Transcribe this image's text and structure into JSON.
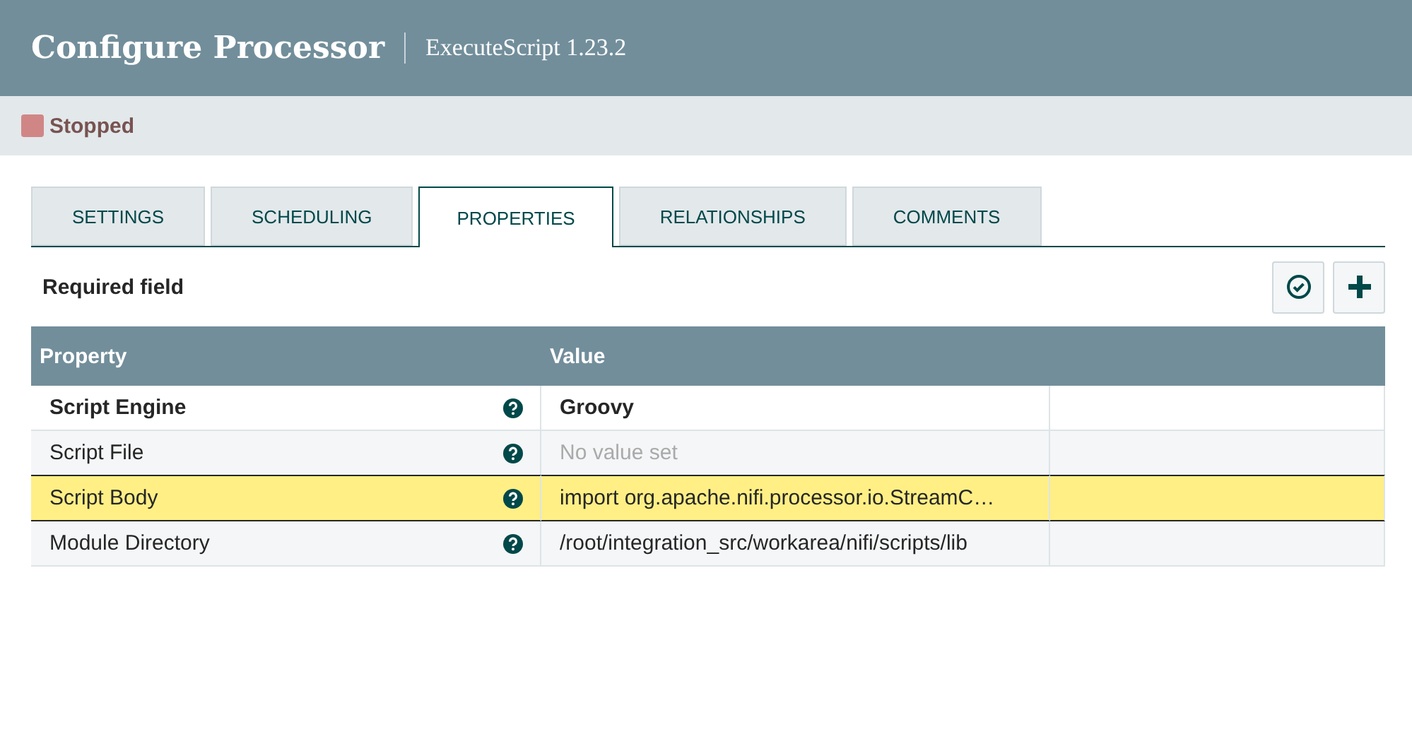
{
  "header": {
    "title": "Configure Processor",
    "subtitle": "ExecuteScript 1.23.2"
  },
  "status": {
    "label": "Stopped",
    "running": false
  },
  "tabs": [
    {
      "label": "SETTINGS",
      "selected": false
    },
    {
      "label": "SCHEDULING",
      "selected": false
    },
    {
      "label": "PROPERTIES",
      "selected": true
    },
    {
      "label": "RELATIONSHIPS",
      "selected": false
    },
    {
      "label": "COMMENTS",
      "selected": false
    }
  ],
  "required_note": "Required field",
  "table": {
    "columns": [
      "Property",
      "Value"
    ],
    "rows": [
      {
        "property": "Script Engine",
        "value": "Groovy",
        "required": true,
        "value_set": true,
        "selected": false
      },
      {
        "property": "Script File",
        "value": "No value set",
        "required": false,
        "value_set": false,
        "selected": false
      },
      {
        "property": "Script Body",
        "value": "import org.apache.nifi.processor.io.StreamC…",
        "required": false,
        "value_set": true,
        "selected": true
      },
      {
        "property": "Module Directory",
        "value": "/root/integration_src/workarea/nifi/scripts/lib",
        "required": false,
        "value_set": true,
        "selected": false
      }
    ]
  }
}
